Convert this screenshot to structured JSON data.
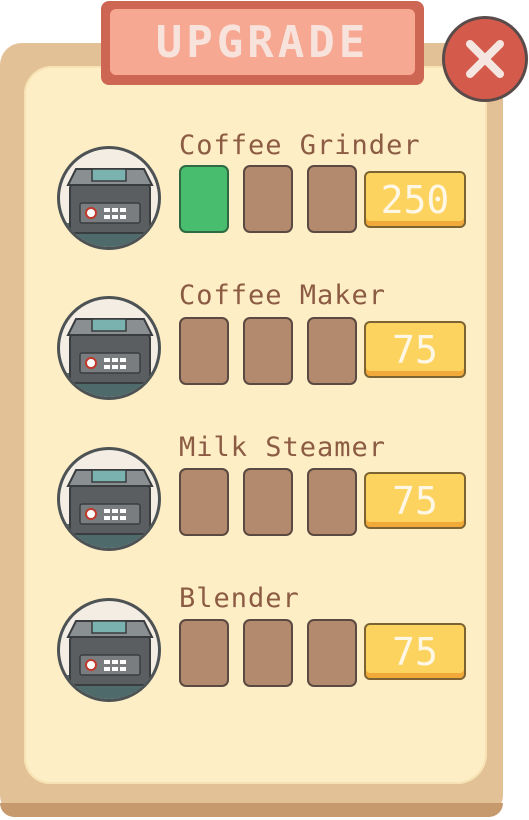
{
  "title": "UPGRADE",
  "colors": {
    "board": "#e2c197",
    "paper": "#fdeec5",
    "banner": "#f7a893",
    "close_button": "#d45b4c",
    "slot_filled": "#48bd6e",
    "slot_empty": "#b48a6e",
    "price_button": "#fdd35f"
  },
  "close_icon": "close-x-icon",
  "items": [
    {
      "name": "Coffee Grinder",
      "level": 1,
      "max_level": 3,
      "price": "250",
      "icon": "machine-icon"
    },
    {
      "name": "Coffee Maker",
      "level": 0,
      "max_level": 3,
      "price": "75",
      "icon": "machine-icon"
    },
    {
      "name": "Milk Steamer",
      "level": 0,
      "max_level": 3,
      "price": "75",
      "icon": "machine-icon"
    },
    {
      "name": "Blender",
      "level": 0,
      "max_level": 3,
      "price": "75",
      "icon": "machine-icon"
    }
  ]
}
